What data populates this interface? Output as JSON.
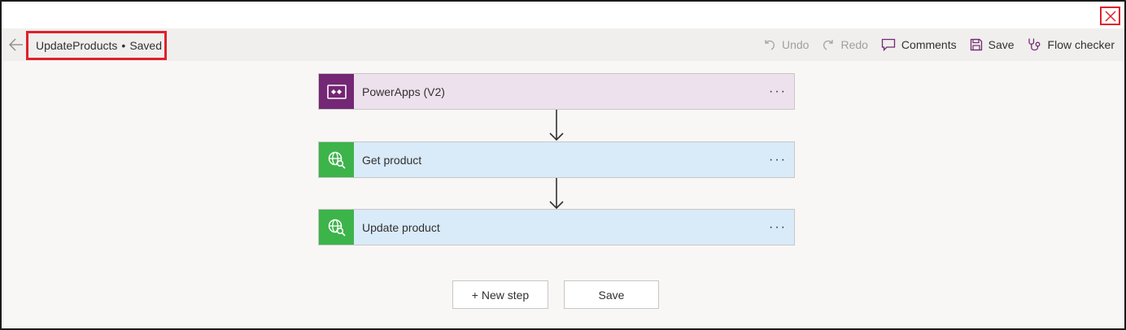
{
  "window": {
    "close_icon": "close-icon"
  },
  "header": {
    "back_icon": "back-arrow-icon",
    "flow_name": "UpdateProducts",
    "separator": "•",
    "status": "Saved",
    "actions": {
      "undo": "Undo",
      "redo": "Redo",
      "comments": "Comments",
      "save": "Save",
      "flow_checker": "Flow checker"
    }
  },
  "steps": [
    {
      "label": "PowerApps (V2)",
      "icon": "powerapps-icon",
      "color": "#742774",
      "bg": "#ece1ec",
      "more": "···"
    },
    {
      "label": "Get product",
      "icon": "globe-search-icon",
      "color": "#3cb44a",
      "bg": "#d9eaf9",
      "more": "···"
    },
    {
      "label": "Update product",
      "icon": "globe-search-icon",
      "color": "#3cb44a",
      "bg": "#d9eaf9",
      "more": "···"
    }
  ],
  "footer": {
    "new_step": "+ New step",
    "save": "Save"
  },
  "colors": {
    "highlight": "#e0202a",
    "disabled_text": "#a19f9d",
    "canvas": "#f8f7f5"
  }
}
